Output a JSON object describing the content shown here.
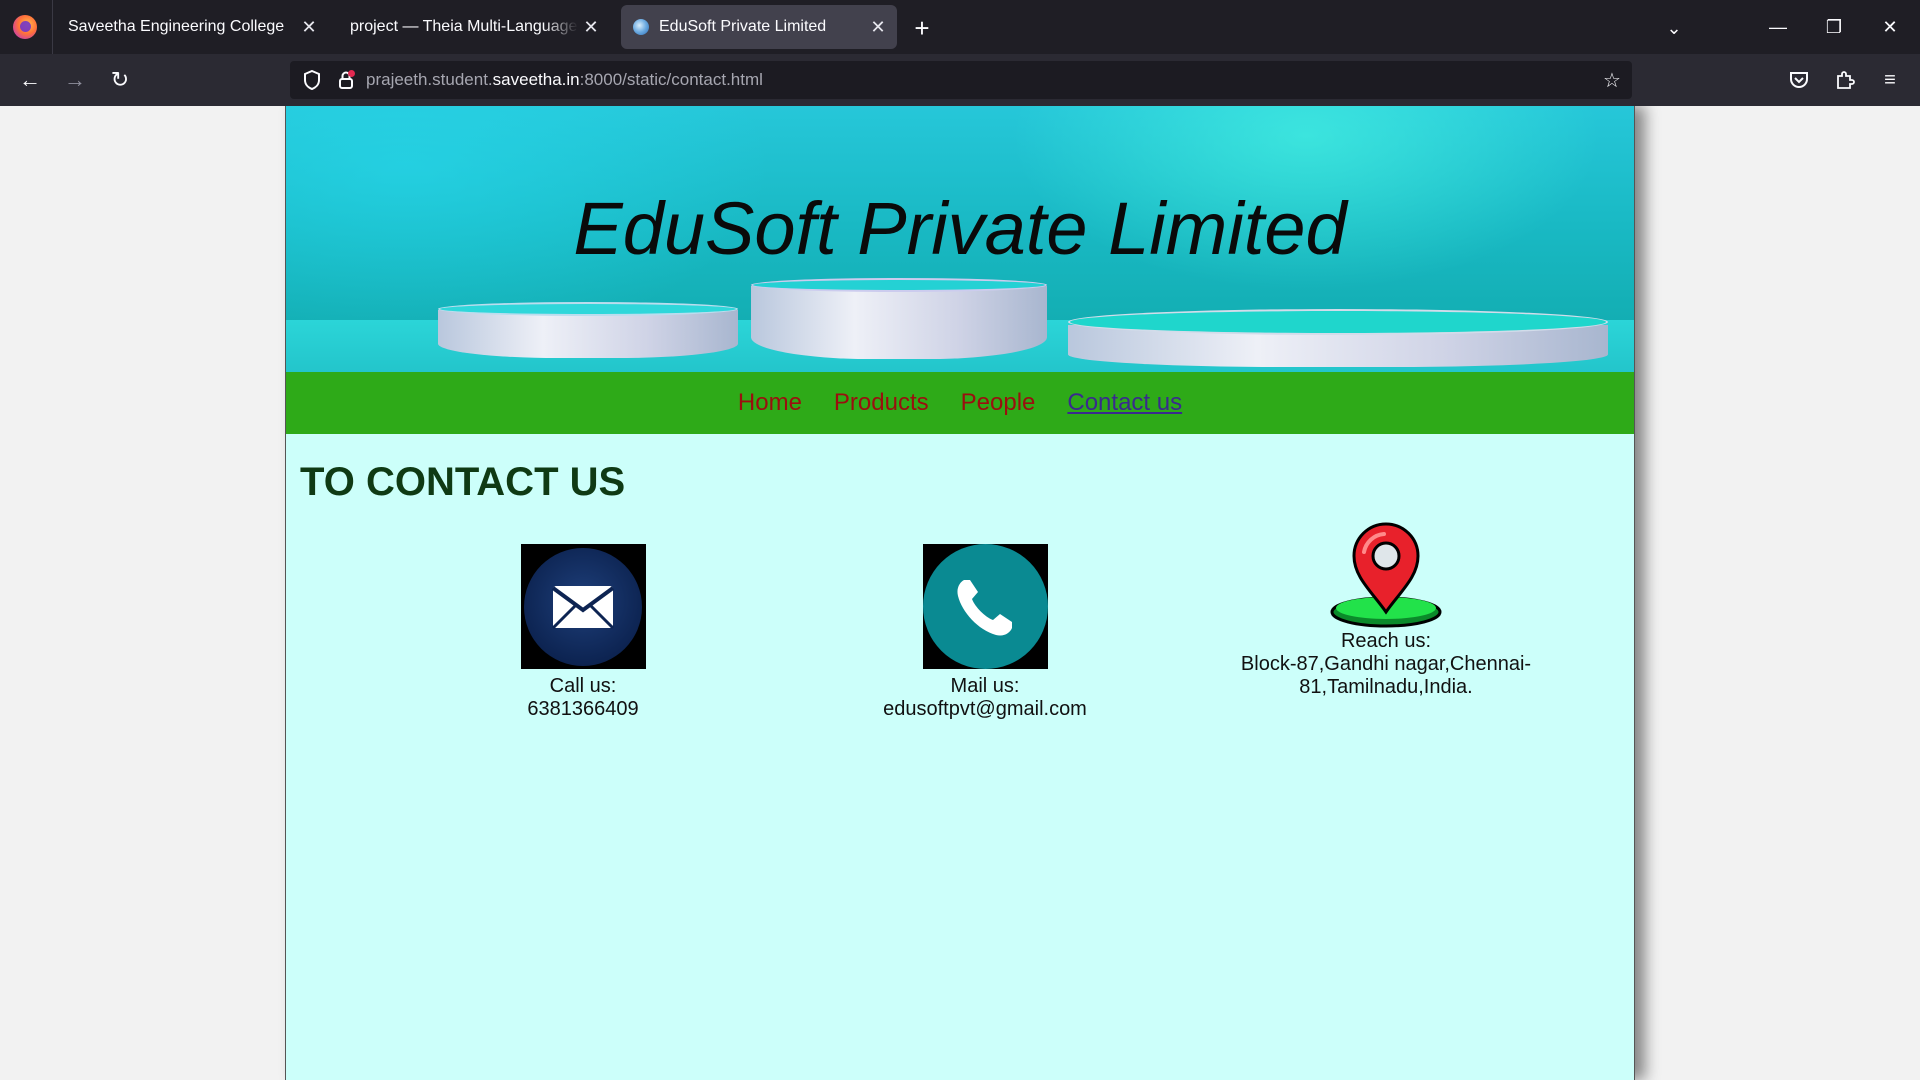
{
  "browser": {
    "tabs": [
      {
        "title": "Saveetha Engineering College",
        "close": "✕"
      },
      {
        "title": "project — Theia Multi-Language Explorer",
        "close": "✕"
      },
      {
        "title": "EduSoft Private Limited",
        "close": "✕"
      }
    ],
    "new_tab": "+",
    "tab_list": "⌄",
    "window": {
      "minimize": "—",
      "maximize": "❐",
      "close": "✕"
    },
    "url": {
      "prefix": "prajeeth.student.",
      "domain": "saveetha.in",
      "suffix": ":8000/static/contact.html"
    },
    "nav": {
      "back": "←",
      "forward": "→",
      "reload": "↻"
    },
    "icons": {
      "shield": "⛉",
      "lock": "🔒",
      "star": "☆",
      "pocket": "⛉",
      "extensions": "⧉",
      "menu": "≡"
    }
  },
  "page": {
    "banner_title": "EduSoft Private Limited",
    "menu": [
      {
        "label": "Home",
        "active": false
      },
      {
        "label": "Products",
        "active": false
      },
      {
        "label": "People",
        "active": false
      },
      {
        "label": "Contact us",
        "active": true
      }
    ],
    "heading": "TO CONTACT US",
    "contacts": [
      {
        "icon": "mail-icon",
        "label": "Call us:",
        "value": "6381366409"
      },
      {
        "icon": "phone-icon",
        "label": "Mail us:",
        "value": "edusoftpvt@gmail.com"
      },
      {
        "icon": "location-pin-icon",
        "label": "Reach us:",
        "value": "Block-87,Gandhi nagar,Chennai-81,Tamilnadu,India."
      }
    ],
    "colors": {
      "menu_bg": "#2eaa18",
      "menu_link": "#9b0f0f",
      "page_bg": "#ccfffa",
      "heading": "#0f3a14"
    }
  }
}
